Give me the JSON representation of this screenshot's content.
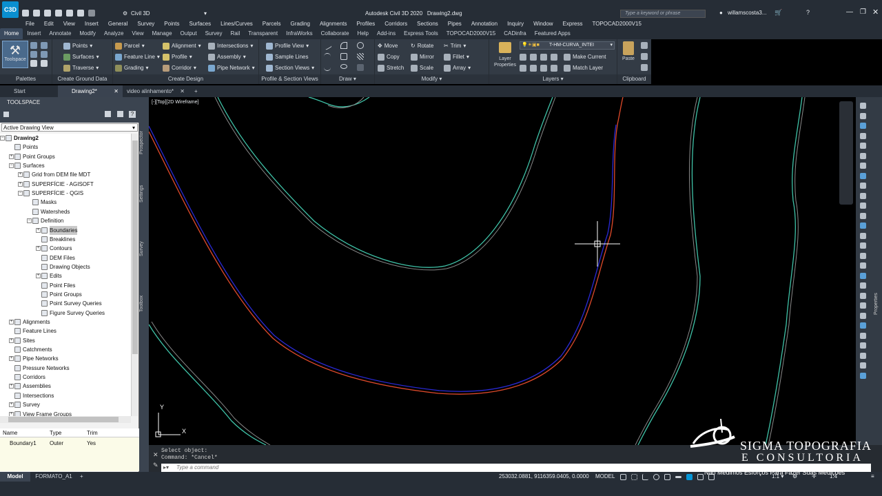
{
  "app": {
    "title": "Autodesk Civil 3D 2020",
    "document": "Drawing2.dwg",
    "workspace": "Civil 3D",
    "search_placeholder": "Type a keyword or phrase",
    "user": "willamscosta3..."
  },
  "menu": [
    "File",
    "Edit",
    "View",
    "Insert",
    "General",
    "Survey",
    "Points",
    "Surfaces",
    "Lines/Curves",
    "Parcels",
    "Grading",
    "Alignments",
    "Profiles",
    "Corridors",
    "Sections",
    "Pipes",
    "Annotation",
    "Inquiry",
    "Window",
    "Express",
    "TOPOCAD2000V15"
  ],
  "ribbon_tabs": [
    "Home",
    "Insert",
    "Annotate",
    "Modify",
    "Analyze",
    "View",
    "Manage",
    "Output",
    "Survey",
    "Rail",
    "Transparent",
    "InfraWorks",
    "Collaborate",
    "Help",
    "Add-ins",
    "Express Tools",
    "TOPOCAD2000V15",
    "CADinfra",
    "Featured Apps"
  ],
  "ribbon": {
    "palettes": {
      "toolspace": "Toolspace",
      "title": "Palettes"
    },
    "ground": {
      "points": "Points",
      "surfaces": "Surfaces",
      "traverse": "Traverse",
      "title": "Create Ground Data"
    },
    "design": {
      "parcel": "Parcel",
      "feature_line": "Feature Line",
      "grading": "Grading",
      "alignment": "Alignment",
      "profile": "Profile",
      "corridor": "Corridor",
      "intersections": "Intersections",
      "assembly": "Assembly",
      "pipe_network": "Pipe Network",
      "title": "Create Design"
    },
    "profile_section": {
      "profile_view": "Profile View",
      "sample_lines": "Sample Lines",
      "section_views": "Section Views",
      "title": "Profile & Section Views"
    },
    "draw": {
      "title": "Draw"
    },
    "modify": {
      "move": "Move",
      "copy": "Copy",
      "stretch": "Stretch",
      "rotate": "Rotate",
      "mirror": "Mirror",
      "scale": "Scale",
      "trim": "Trim",
      "fillet": "Fillet",
      "array": "Array",
      "title": "Modify"
    },
    "layers": {
      "layer_properties": "Layer Properties",
      "current_layer": "T-HM-CURVA_INTEI",
      "make_current": "Make Current",
      "match_layer": "Match Layer",
      "title": "Layers"
    },
    "clipboard": {
      "paste": "Paste",
      "title": "Clipboard"
    }
  },
  "file_tabs": [
    {
      "label": "Start"
    },
    {
      "label": "Drawing2*"
    },
    {
      "label": "video alinhamento*"
    }
  ],
  "toolspace": {
    "header": "TOOLSPACE",
    "view_select": "Active Drawing View",
    "tree": [
      {
        "label": "Drawing2",
        "bold": true
      },
      {
        "label": "Points"
      },
      {
        "label": "Point Groups"
      },
      {
        "label": "Surfaces"
      },
      {
        "label": "Grid from DEM file MDT"
      },
      {
        "label": "SUPERFÍCIE - AGISOFT"
      },
      {
        "label": "SUPERFÍCIE - QGIS"
      },
      {
        "label": "Masks"
      },
      {
        "label": "Watersheds"
      },
      {
        "label": "Definition"
      },
      {
        "label": "Boundaries",
        "selected": true
      },
      {
        "label": "Breaklines"
      },
      {
        "label": "Contours"
      },
      {
        "label": "DEM Files"
      },
      {
        "label": "Drawing Objects"
      },
      {
        "label": "Edits"
      },
      {
        "label": "Point Files"
      },
      {
        "label": "Point Groups"
      },
      {
        "label": "Point Survey Queries"
      },
      {
        "label": "Figure Survey Queries"
      },
      {
        "label": "Alignments"
      },
      {
        "label": "Feature Lines"
      },
      {
        "label": "Sites"
      },
      {
        "label": "Catchments"
      },
      {
        "label": "Pipe Networks"
      },
      {
        "label": "Pressure Networks"
      },
      {
        "label": "Corridors"
      },
      {
        "label": "Assemblies"
      },
      {
        "label": "Intersections"
      },
      {
        "label": "Survey"
      },
      {
        "label": "View Frame Groups"
      }
    ],
    "vertical_tabs": [
      "Prospector",
      "Settings",
      "Survey",
      "Toolbox"
    ],
    "table": {
      "headers": [
        "Name",
        "Type",
        "Trim"
      ],
      "rows": [
        [
          "Boundary1",
          "Outer",
          "Yes"
        ]
      ]
    }
  },
  "viewport": {
    "label": "[-][Top][2D Wireframe]",
    "ucs_y": "Y",
    "ucs_x": "X"
  },
  "command": {
    "line1": "Select object:",
    "line2": "Command: *Cancel*",
    "placeholder": "Type a command"
  },
  "status": {
    "model_tab": "Model",
    "layout_tab": "FORMATO_A1",
    "coords": "253032.0881, 9116359.0405, 0.0000",
    "space": "MODEL",
    "scale": "1:1",
    "props_tab": "Properties",
    "annoscale": "1.4"
  },
  "watermark": {
    "line1": "SIGMA TOPOGRAFIA",
    "line2": "E CONSULTORIA",
    "line3": "Não Medimos Esforços Para Fazer Suas Medições"
  },
  "colors": {
    "contour": "#3fc3a8",
    "boundary_red": "#e04a2a",
    "boundary_blue": "#2a2ad8",
    "accent": "#0696d7"
  }
}
